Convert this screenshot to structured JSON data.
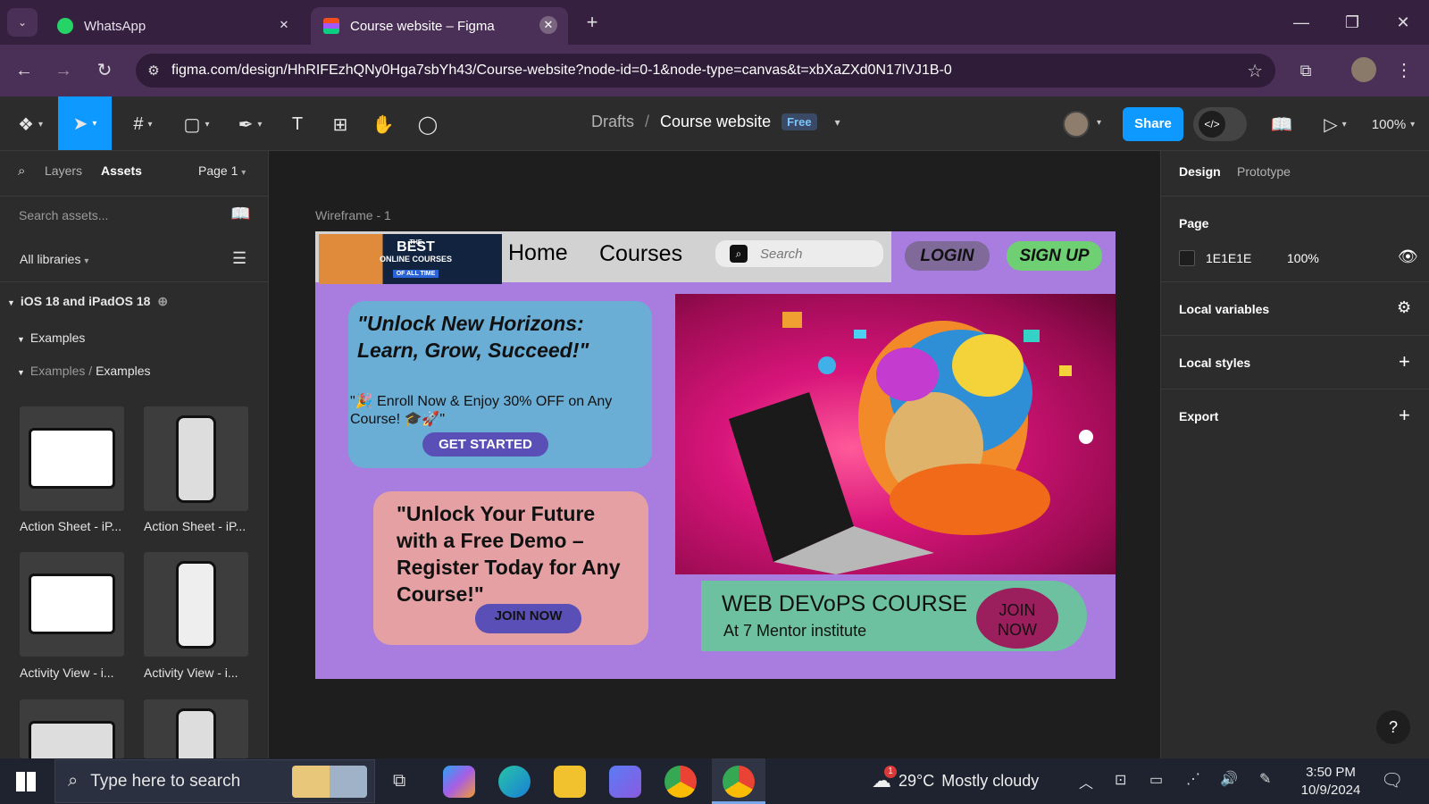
{
  "browser": {
    "tabs": [
      {
        "title": "WhatsApp",
        "icon": "whatsapp-icon",
        "active": false
      },
      {
        "title": "Course website – Figma",
        "icon": "figma-icon",
        "active": true
      }
    ],
    "url": "figma.com/design/HhRIFEzhQNy0Hga7sbYh43/Course-website?node-id=0-1&node-type=canvas&t=xbXaZXd0N17lVJ1B-0"
  },
  "figma": {
    "breadcrumb": {
      "parent": "Drafts",
      "separator": "/",
      "file": "Course website",
      "badge": "Free"
    },
    "share_label": "Share",
    "zoom": "100%",
    "left_panel": {
      "tabs": [
        "Layers",
        "Assets"
      ],
      "page_selector": "Page 1",
      "search_placeholder": "Search assets...",
      "libraries": "All libraries",
      "library_name": "iOS 18 and iPadOS 18",
      "group": "Examples",
      "subgroup_parent": "Examples",
      "subgroup_sep": "/",
      "subgroup": "Examples",
      "components": [
        {
          "label": "Action Sheet - iP...",
          "kind": "tablet"
        },
        {
          "label": "Action Sheet - iP...",
          "kind": "phone"
        },
        {
          "label": "Activity View - i...",
          "kind": "tablet"
        },
        {
          "label": "Activity View - i...",
          "kind": "phone"
        }
      ]
    },
    "canvas": {
      "frame_name": "Wireframe - 1",
      "site": {
        "banner_small": "THE",
        "banner_big": "BEST",
        "banner_line1": "ONLINE COURSES",
        "banner_line2": "OF ALL TIME",
        "nav_home": "Home",
        "nav_courses": "Courses",
        "search_placeholder": "Search",
        "login": "LOGIN",
        "signup": "SIGN UP",
        "hero_title": "\"Unlock New Horizons: Learn, Grow, Succeed!\"",
        "hero_sub": "\"🎉 Enroll Now & Enjoy 30% OFF on Any Course! 🎓🚀\"",
        "hero_cta": "GET STARTED",
        "demo_text": "\"Unlock Your Future with a Free Demo – Register Today for Any Course!\"",
        "demo_cta": "JOIN NOW",
        "course_title": "WEB DEVoPS COURSE",
        "course_sub": "At 7 Mentor institute",
        "course_cta_line1": "JOIN",
        "course_cta_line2": "NOW"
      }
    },
    "right_panel": {
      "tabs": [
        "Design",
        "Prototype"
      ],
      "page_heading": "Page",
      "page_color": "1E1E1E",
      "page_opacity": "100%",
      "sections": [
        "Local variables",
        "Local styles",
        "Export"
      ]
    }
  },
  "taskbar": {
    "search_placeholder": "Type here to search",
    "weather_temp": "29°C",
    "weather_desc": "Mostly cloudy",
    "weather_badge": "1",
    "time": "3:50 PM",
    "date": "10/9/2024"
  },
  "colors": {
    "figma_blue": "#0d99ff",
    "frame_bg": "#a97ddf",
    "hero_card": "#6aaed6",
    "demo_card": "#e4a0a3",
    "course_card": "#6dc1a1",
    "cta_dark": "#5a4fb6"
  }
}
